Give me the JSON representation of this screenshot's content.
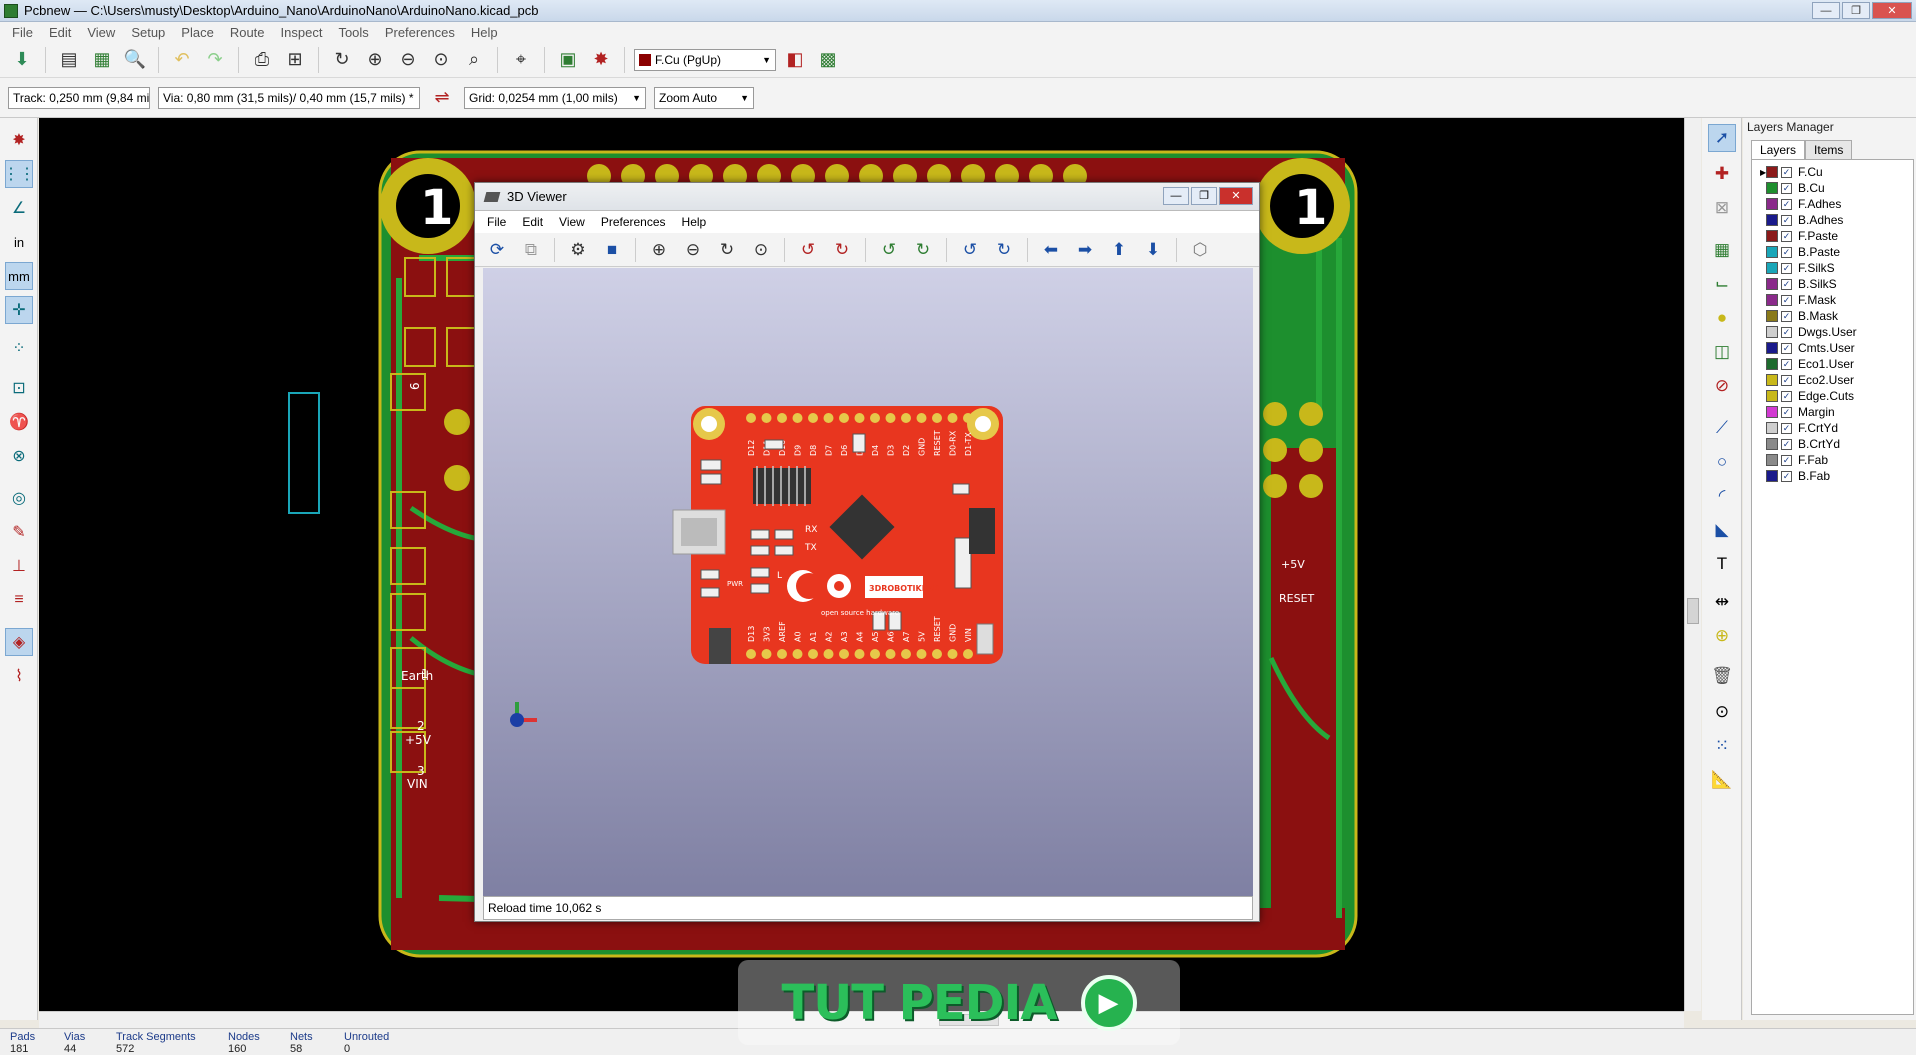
{
  "window": {
    "title": "Pcbnew — C:\\Users\\musty\\Desktop\\Arduino_Nano\\ArduinoNano\\ArduinoNano.kicad_pcb",
    "minimize": "—",
    "maximize": "❐",
    "close": "✕"
  },
  "menu": [
    "File",
    "Edit",
    "View",
    "Setup",
    "Place",
    "Route",
    "Inspect",
    "Tools",
    "Preferences",
    "Help"
  ],
  "toolbar": {
    "active_layer": "F.Cu (PgUp)"
  },
  "toolbar2": {
    "track": "Track: 0,250 mm (9,84 mils) *",
    "via": "Via: 0,80 mm (31,5 mils)/ 0,40 mm (15,7 mils) *",
    "grid": "Grid: 0,0254 mm (1,00 mils)",
    "zoom": "Zoom Auto"
  },
  "left_tools": {
    "units_in": "in",
    "units_mm": "mm"
  },
  "layers_manager": {
    "title": "Layers Manager",
    "tabs": [
      "Layers",
      "Items"
    ],
    "layers": [
      {
        "name": "F.Cu",
        "color": "#8b1a1a",
        "current": true
      },
      {
        "name": "B.Cu",
        "color": "#1e8f2e",
        "current": false
      },
      {
        "name": "F.Adhes",
        "color": "#8a2a8a",
        "current": false
      },
      {
        "name": "B.Adhes",
        "color": "#1a1a8b",
        "current": false
      },
      {
        "name": "F.Paste",
        "color": "#8b1a1a",
        "current": false
      },
      {
        "name": "B.Paste",
        "color": "#1aa6b8",
        "current": false
      },
      {
        "name": "F.SilkS",
        "color": "#1aa6b8",
        "current": false
      },
      {
        "name": "B.SilkS",
        "color": "#8a2a8a",
        "current": false
      },
      {
        "name": "F.Mask",
        "color": "#8a2a8a",
        "current": false
      },
      {
        "name": "B.Mask",
        "color": "#8a7a1a",
        "current": false
      },
      {
        "name": "Dwgs.User",
        "color": "#cfcfcf",
        "current": false
      },
      {
        "name": "Cmts.User",
        "color": "#1a1a8b",
        "current": false
      },
      {
        "name": "Eco1.User",
        "color": "#1e6b2e",
        "current": false
      },
      {
        "name": "Eco2.User",
        "color": "#c8b81a",
        "current": false
      },
      {
        "name": "Edge.Cuts",
        "color": "#c8b81a",
        "current": false
      },
      {
        "name": "Margin",
        "color": "#d13ad1",
        "current": false
      },
      {
        "name": "F.CrtYd",
        "color": "#cfcfcf",
        "current": false
      },
      {
        "name": "B.CrtYd",
        "color": "#8a8a8a",
        "current": false
      },
      {
        "name": "F.Fab",
        "color": "#8a8a8a",
        "current": false
      },
      {
        "name": "B.Fab",
        "color": "#1a1a8b",
        "current": false
      }
    ]
  },
  "status": [
    {
      "label": "Pads",
      "value": "181"
    },
    {
      "label": "Vias",
      "value": "44"
    },
    {
      "label": "Track Segments",
      "value": "572"
    },
    {
      "label": "Nodes",
      "value": "160"
    },
    {
      "label": "Nets",
      "value": "58"
    },
    {
      "label": "Unrouted",
      "value": "0"
    }
  ],
  "viewer3d": {
    "title": "3D Viewer",
    "menu": [
      "File",
      "Edit",
      "View",
      "Preferences",
      "Help"
    ],
    "status": "Reload time 10,062 s"
  },
  "pcb_labels": {
    "top_pins": [
      "D12",
      "D11",
      "D10",
      "D9",
      "D8",
      "D7",
      "D6",
      "D5",
      "D4",
      "D3",
      "D2",
      "GND",
      "RESET",
      "D0-RX",
      "D1-TX"
    ],
    "bottom_pins": [
      "D13",
      "3V3",
      "AREF",
      "A0",
      "A1",
      "A2",
      "A3",
      "A4",
      "A5",
      "A6",
      "A7",
      "5V",
      "RESET",
      "GND",
      "VIN"
    ],
    "silk_rx": "RX",
    "silk_tx": "TX",
    "silk_pwr": "PWR",
    "silk_l": "L",
    "brand": "3DROBOTIKLAB",
    "oshw": "open source hardware",
    "earth": "Earth",
    "plus5v": "+5V",
    "vin": "VIN",
    "reset": "RESET",
    "one": "1",
    "two": "2",
    "three": "3",
    "six": "6"
  },
  "watermark": {
    "text": "TUT PEDIA"
  }
}
